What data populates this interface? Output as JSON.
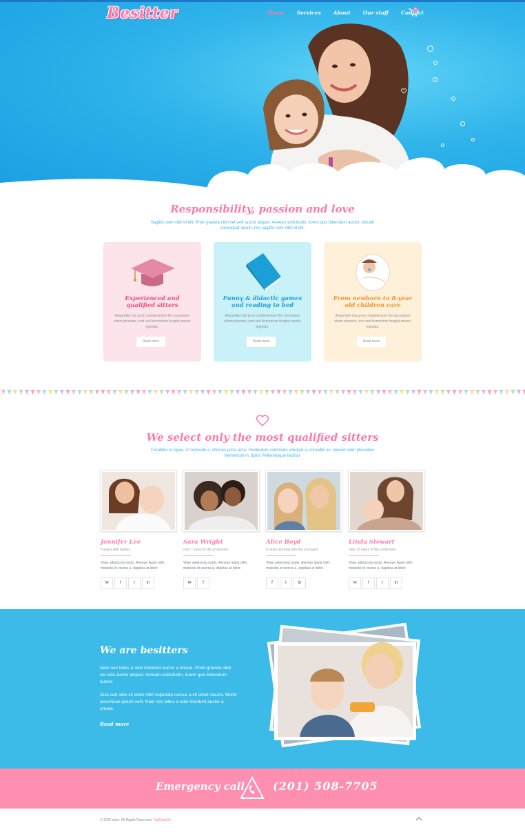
{
  "header": {
    "logo": "Besitter",
    "nav": [
      {
        "label": "Home"
      },
      {
        "label": "Services"
      },
      {
        "label": "About"
      },
      {
        "label": "Our staff"
      },
      {
        "label": "Contact"
      }
    ],
    "cart_count": "0"
  },
  "features": {
    "title": "Responsibility, passion and love",
    "subtitle": "Sagittis sem nibh id elit. Proin gravida nibh vel velit auctor aliquet. Aenean sollicitudin, lorem quis bibendum auctor, nisi elit consequat ipsum, nec sagittis sem nibh id elit.",
    "cards": [
      {
        "title": "Experienced and qualified sitters",
        "text": "Amperdiet nisi proin condimentum fen uncrelaner etiam pharetra, erat sed fermentum feugiat,mauris egestas.",
        "button": "Read more",
        "bg": "#fde3ea",
        "accent": "#ee4a84"
      },
      {
        "title": "Funny & didactic games and reading to bed",
        "text": "Amperdiet nisi proin condimentum fen uncrelaner etiam pharetra, erat sed fermentum feugiat,mauris egestas.",
        "button": "Read more",
        "bg": "#c9f1f8",
        "accent": "#1c9fd6"
      },
      {
        "title": "From newborn to 8-year old children care",
        "text": "Amperdiet nisi proin condimentum fen uncrelaner etiam pharetra, erat sed fermentum feugiat,mauris egestas.",
        "button": "Read more",
        "bg": "#fff1d9",
        "accent": "#f0912c"
      }
    ]
  },
  "team": {
    "title": "We select only the most qualified sitters",
    "subtitle": "Curabitur et ligula. Ut molestie a, ultricies porta urna. Vestibulum commodo volutpat a, convallis ac, laoreet enim phasellus fermentum in, dolor. Pellentesque facilisis",
    "members": [
      {
        "name": "Jennifer Lee",
        "role": "5 years with babies",
        "text": "Vitae adipiscing turpis. Aenean ligula nibh, molestie id viverra a, dapibus at dolor.",
        "socials": [
          "✉",
          "f",
          "t",
          "in"
        ]
      },
      {
        "name": "Sara Wright",
        "role": "over 7 years in the profession",
        "text": "Vitae adipiscing turpis. Aenean ligula nibh, molestie id viverra a, dapibus at dolor.",
        "socials": [
          "✉",
          "f"
        ]
      },
      {
        "name": "Alice Boyd",
        "role": "5 years working with the youngest",
        "text": "Vitae adipiscing turpis. Aenean ligula nibh, molestie id viverra a, dapibus at dolor.",
        "socials": [
          "f",
          "t",
          "in"
        ]
      },
      {
        "name": "Linda Stewart",
        "role": "over 10 years in the profession",
        "text": "Vitae adipiscing turpis. Aenean ligula nibh, molestie id viverra a, dapibus at dolor.",
        "socials": [
          "✉",
          "f",
          "t",
          "in"
        ]
      }
    ]
  },
  "about": {
    "title": "We are besitters",
    "p1": "Nam nec tellus a odio tincidunt auctor a ornare. Proin gravida nibh vel velit auctor aliquet. Aenean sollicitudin, lorem quis bibendum auctor.",
    "p2": "Duis sed odio sit amet nibh vulputate cursus a sit amet mauris. Morbi accumsan ipsum velit. Nam nec tellus a odio tincidunt auctor a ornare.",
    "link": "Read more"
  },
  "emergency": {
    "label": "Emergency call",
    "phone": "(201) 508-7705"
  },
  "footer": {
    "copyright": "© 2020 sitter. All Rights Reserved.",
    "link": "TopRankOn"
  },
  "colors": {
    "primary_blue": "#3cbbe8",
    "pink": "#ff7aac",
    "emergency_bg": "#ff8fb1"
  }
}
